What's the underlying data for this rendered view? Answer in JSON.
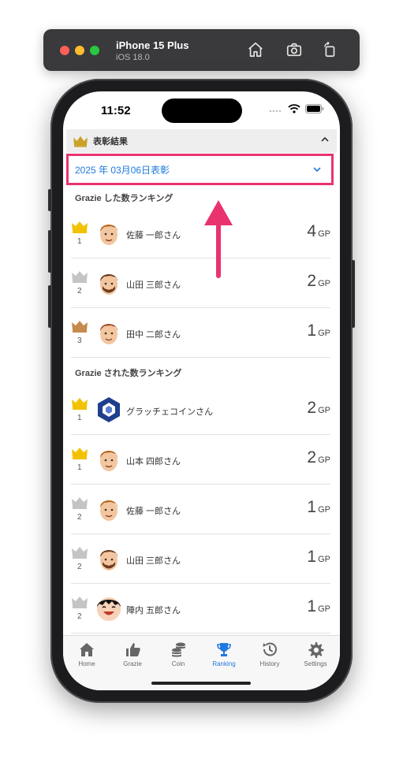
{
  "simulator": {
    "device": "iPhone 15 Plus",
    "os": "iOS 18.0"
  },
  "status": {
    "time": "11:52"
  },
  "award": {
    "header": "表彰結果",
    "selected_date": "2025 年 03月06日表彰"
  },
  "given_ranking": {
    "title": "Grazie した数ランキング",
    "rows": [
      {
        "rank": "1",
        "crown": "gold",
        "name": "佐藤 一郎",
        "suffix": "さん",
        "gp": "4",
        "unit": "GP",
        "avatar": "man-brown-hair"
      },
      {
        "rank": "2",
        "crown": "silver",
        "name": "山田 三郎",
        "suffix": "さん",
        "gp": "2",
        "unit": "GP",
        "avatar": "man-beard"
      },
      {
        "rank": "3",
        "crown": "bronze",
        "name": "田中 二郎",
        "suffix": "さん",
        "gp": "1",
        "unit": "GP",
        "avatar": "man-smile"
      }
    ]
  },
  "received_ranking": {
    "title": "Grazie された数ランキング",
    "rows": [
      {
        "rank": "1",
        "crown": "gold",
        "name": "グラッチェコイン",
        "suffix": "さん",
        "gp": "2",
        "unit": "GP",
        "avatar": "coin-logo"
      },
      {
        "rank": "1",
        "crown": "gold",
        "name": "山本 四郎",
        "suffix": "さん",
        "gp": "2",
        "unit": "GP",
        "avatar": "man-brown-hair"
      },
      {
        "rank": "2",
        "crown": "silver",
        "name": "佐藤 一郎",
        "suffix": "さん",
        "gp": "1",
        "unit": "GP",
        "avatar": "man-brown-hair"
      },
      {
        "rank": "2",
        "crown": "silver",
        "name": "山田 三郎",
        "suffix": "さん",
        "gp": "1",
        "unit": "GP",
        "avatar": "man-beard"
      },
      {
        "rank": "2",
        "crown": "silver",
        "name": "陣内 五郎",
        "suffix": "さん",
        "gp": "1",
        "unit": "GP",
        "avatar": "boy-laughing"
      }
    ]
  },
  "tabs": [
    {
      "label": "Home",
      "icon": "home-icon",
      "active": false
    },
    {
      "label": "Grazie",
      "icon": "thumbs-up-icon",
      "active": false
    },
    {
      "label": "Coin",
      "icon": "coins-icon",
      "active": false
    },
    {
      "label": "Ranking",
      "icon": "trophy-icon",
      "active": true
    },
    {
      "label": "History",
      "icon": "history-icon",
      "active": false
    },
    {
      "label": "Settings",
      "icon": "gear-icon",
      "active": false
    }
  ],
  "colors": {
    "accent": "#1e7ae0",
    "highlight": "#e9336f",
    "gold": "#f2c200",
    "silver": "#c4c4c4",
    "bronze": "#c68a4d"
  }
}
